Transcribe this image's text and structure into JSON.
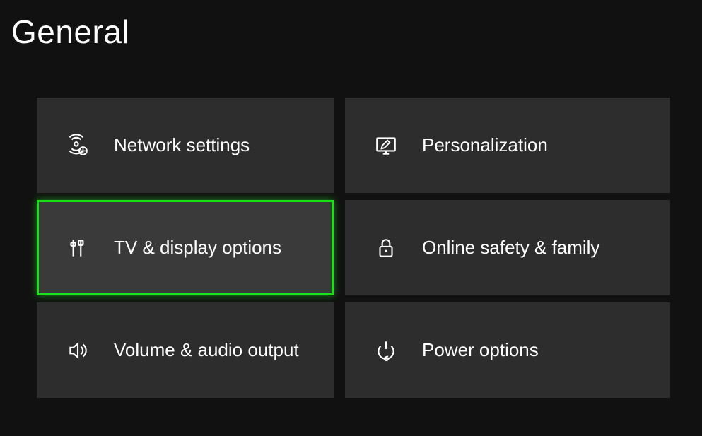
{
  "page": {
    "title": "General"
  },
  "tiles": {
    "network": {
      "label": "Network settings"
    },
    "personalization": {
      "label": "Personalization"
    },
    "display": {
      "label": "TV & display options",
      "selected": true
    },
    "safety": {
      "label": "Online safety & family"
    },
    "audio": {
      "label": "Volume & audio output"
    },
    "power": {
      "label": "Power options"
    }
  }
}
